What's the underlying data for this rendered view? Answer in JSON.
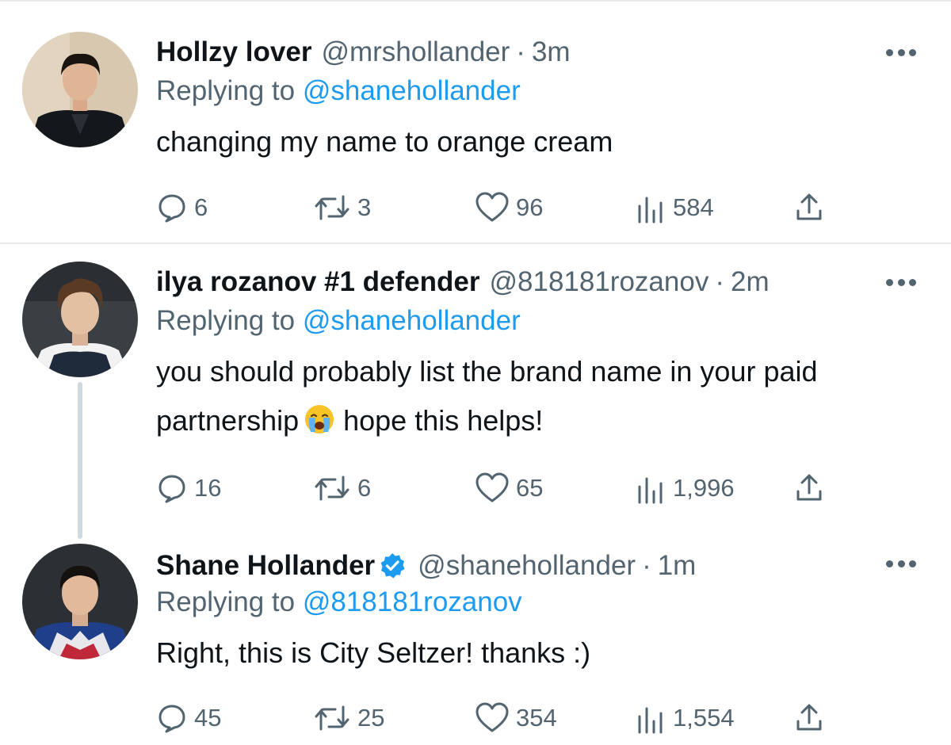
{
  "colors": {
    "text": "#0f1419",
    "muted": "#536471",
    "link": "#1d9bf0",
    "divider": "#e6e8ea",
    "thread_line": "#cfd9de",
    "verified": "#1d9bf0"
  },
  "tweets": [
    {
      "display_name": "Hollzy lover",
      "handle": "@mrshollander",
      "separator": "·",
      "time": "3m",
      "replying_prefix": "Replying to",
      "replying_to": "@shanehollander",
      "text_line1": "changing my name to orange cream",
      "reply_count": "6",
      "retweet_count": "3",
      "like_count": "96",
      "view_count": "584"
    },
    {
      "display_name": "ilya rozanov #1 defender",
      "handle": "@818181rozanov",
      "separator": "·",
      "time": "2m",
      "replying_prefix": "Replying to",
      "replying_to": "@shanehollander",
      "text_line1": "you should probably list the brand name in your paid",
      "text_line2_a": "partnership",
      "emoji": "loudly-crying-face",
      "text_line2_b": "hope this helps!",
      "reply_count": "16",
      "retweet_count": "6",
      "like_count": "65",
      "view_count": "1,996"
    },
    {
      "display_name": "Shane Hollander",
      "verified": true,
      "handle": "@shanehollander",
      "separator": "·",
      "time": "1m",
      "replying_prefix": "Replying to",
      "replying_to": "@818181rozanov",
      "text_line1": "Right, this is City Seltzer! thanks :)",
      "reply_count": "45",
      "retweet_count": "25",
      "like_count": "354",
      "view_count": "1,554"
    }
  ],
  "icons": {
    "reply": "speech-bubble-icon",
    "retweet": "retweet-arrows-icon",
    "like": "heart-icon",
    "views": "bar-chart-icon",
    "share": "upload-arrow-icon",
    "more": "three-dots-icon",
    "verified": "verified-badge-icon"
  }
}
